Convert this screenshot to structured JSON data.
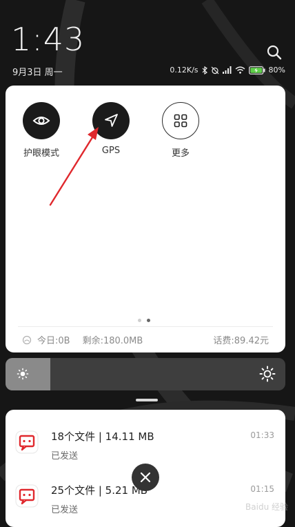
{
  "status_header": {
    "time": "1:43",
    "date": "9月3日 周一",
    "net_speed": "0.12K/s",
    "battery": "80%"
  },
  "quick_settings": {
    "tiles": [
      {
        "label": "护眼模式",
        "icon": "eye-icon",
        "state": "on"
      },
      {
        "label": "GPS",
        "icon": "location-arrow-icon",
        "state": "on"
      },
      {
        "label": "更多",
        "icon": "grid-icon",
        "state": "off"
      }
    ],
    "pages": 2,
    "active_page": 2,
    "data_usage": {
      "today": "今日:0B",
      "remaining": "剩余:180.0MB",
      "balance": "话费:89.42元"
    }
  },
  "brightness": {
    "level": 0.16
  },
  "notifications": [
    {
      "title": "18个文件 | 14.11 MB",
      "subtitle": "已发送",
      "time": "01:33",
      "icon": "file-transfer-icon"
    },
    {
      "title": "25个文件 | 5.21 MB",
      "subtitle": "已发送",
      "time": "01:15",
      "icon": "file-transfer-icon"
    }
  ],
  "colors": {
    "accent_red": "#e0282d",
    "card_bg": "#ffffff",
    "panel_bg": "#161616"
  },
  "watermark": "Baidu 经验"
}
